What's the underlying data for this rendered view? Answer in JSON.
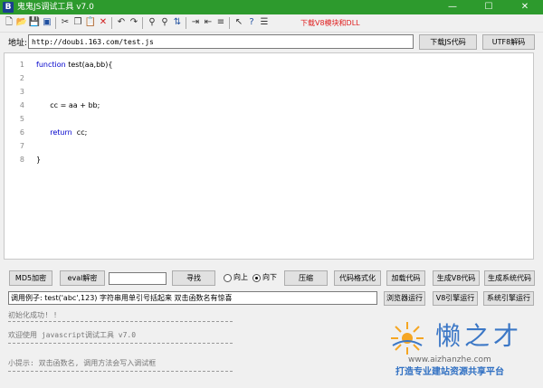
{
  "window": {
    "title": "鬼鬼JS调试工具 v7.0",
    "app_icon": "B",
    "controls": {
      "minimize": "—",
      "maximize": "☐",
      "close": "✕"
    }
  },
  "toolbar": {
    "icons": [
      "new-file-icon",
      "open-folder-icon",
      "save-icon",
      "save-all-icon",
      "cut-icon",
      "copy-icon",
      "paste-icon",
      "delete-icon",
      "undo-icon",
      "redo-icon",
      "find-icon",
      "find-next-icon",
      "sort-icon",
      "indent-icon",
      "outdent-icon",
      "comment-icon",
      "uncomment-icon",
      "pointer-icon",
      "help-icon",
      "list-icon"
    ],
    "download_link": "下载V8模块和DLL"
  },
  "address": {
    "label": "地址:",
    "value": "http://doubi.163.com/test.js",
    "download_button": "下载JS代码",
    "decode_button": "UTF8解码"
  },
  "editor": {
    "lines": [
      {
        "n": "1",
        "keyword": "function",
        "rest": " test(aa,bb){"
      },
      {
        "n": "2",
        "keyword": "",
        "rest": ""
      },
      {
        "n": "3",
        "keyword": "",
        "rest": ""
      },
      {
        "n": "4",
        "keyword": "",
        "rest": "      cc = aa + bb;"
      },
      {
        "n": "5",
        "keyword": "",
        "rest": ""
      },
      {
        "n": "6",
        "keyword": "      return",
        "rest": "  cc;"
      },
      {
        "n": "7",
        "keyword": "",
        "rest": ""
      },
      {
        "n": "8",
        "keyword": "",
        "rest": "}"
      }
    ]
  },
  "controls": {
    "md5_button": "MD5加密",
    "eval_button": "eval解密",
    "search_value": "",
    "find_button": "寻找",
    "radio_up": "向上",
    "radio_down": "向下",
    "compress_button": "压缩",
    "format_button": "代码格式化",
    "load_button": "加载代码",
    "gen_v8_button": "生成V8代码",
    "gen_system_button": "生成系统代码",
    "example_text": "调用例子: test('abc',123) 字符串用单引号括起来 双击函数名有惊喜",
    "browser_run_button": "浏览器运行",
    "v8_run_button": "V8引擎运行",
    "system_run_button": "系统引擎运行"
  },
  "console": {
    "line1": "初始化成功! !",
    "line2": "欢迎使用 javascript调试工具 v7.0",
    "line3": "小提示: 双击函数名, 调用方法会写入调试框"
  },
  "watermark": {
    "brand": "懒之才",
    "url": "www.aizhanzhe.com",
    "slogan": "打造专业建站资源共享平台"
  },
  "colors": {
    "titlebar": "#2d9a2d",
    "keyword": "#0000cc",
    "download_link": "#e02020",
    "watermark_blue": "#3b77c6"
  }
}
